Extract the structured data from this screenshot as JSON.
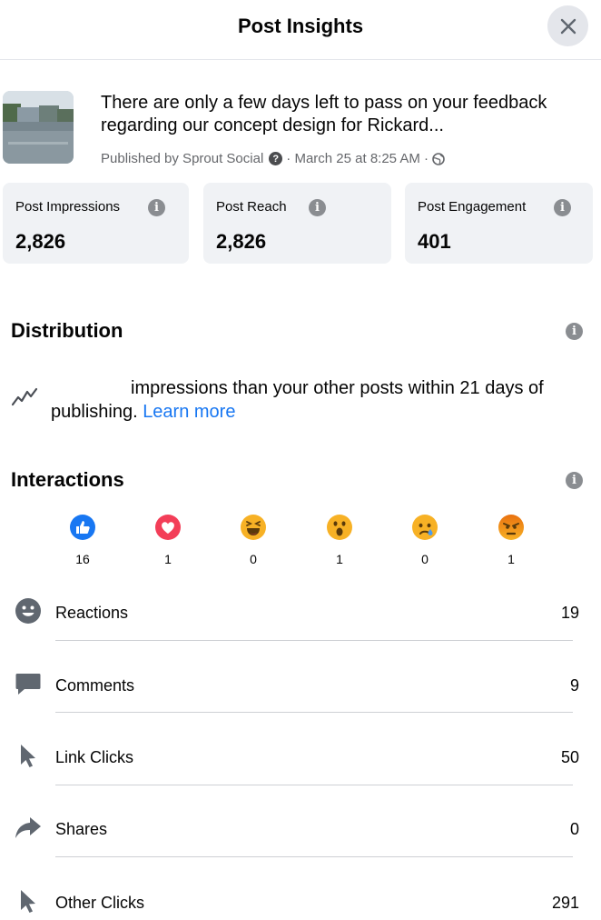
{
  "header": {
    "title": "Post Insights"
  },
  "post": {
    "text": "There are only a few days left to pass on your feedback regarding our concept design for Rickard...",
    "publisher": "Published by Sprout Social",
    "date": "· March 25 at 8:25 AM ·"
  },
  "stats": [
    {
      "label": "Post Impressions",
      "value": "2,826"
    },
    {
      "label": "Post Reach",
      "value": "2,826"
    },
    {
      "label": "Post Engagement",
      "value": "401"
    }
  ],
  "distribution": {
    "title": "Distribution",
    "text": "impressions than your other posts within 21 days of publishing.",
    "link": "Learn more"
  },
  "interactions": {
    "title": "Interactions",
    "reactions": [
      {
        "icon": "like-icon",
        "count": "16"
      },
      {
        "icon": "love-icon",
        "count": "1"
      },
      {
        "icon": "haha-icon",
        "count": "0"
      },
      {
        "icon": "wow-icon",
        "count": "1"
      },
      {
        "icon": "sad-icon",
        "count": "0"
      },
      {
        "icon": "angry-icon",
        "count": "1"
      }
    ],
    "metrics": [
      {
        "label": "Reactions",
        "value": "19",
        "icon": "smiley-icon"
      },
      {
        "label": "Comments",
        "value": "9",
        "icon": "comment-icon"
      },
      {
        "label": "Link Clicks",
        "value": "50",
        "icon": "cursor-icon"
      },
      {
        "label": "Shares",
        "value": "0",
        "icon": "share-icon"
      },
      {
        "label": "Other Clicks",
        "value": "291",
        "icon": "cursor-icon"
      }
    ]
  },
  "colors": {
    "accent": "#1877f2",
    "card_bg": "#f0f2f5",
    "text_secondary": "#65676b"
  }
}
